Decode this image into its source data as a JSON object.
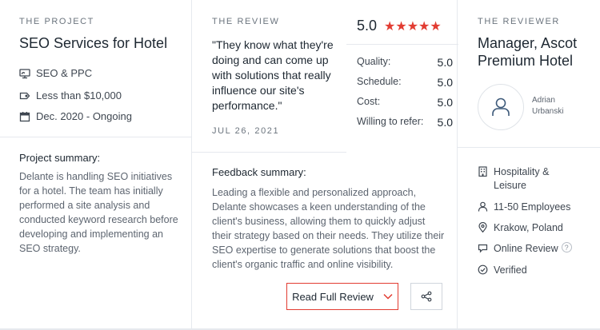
{
  "project": {
    "eyebrow": "THE PROJECT",
    "title": "SEO Services for Hotel",
    "service": "SEO & PPC",
    "budget": "Less than $10,000",
    "timeline": "Dec. 2020 - Ongoing",
    "summary_heading": "Project summary:",
    "summary_text": "Delante is handling SEO initiatives for a hotel. The team has initially performed a site analysis and conducted keyword research before developing and implementing an SEO strategy."
  },
  "review": {
    "eyebrow": "THE REVIEW",
    "quote": "\"They know what they're doing and can come up with solutions that really influence our site's performance.\"",
    "date": "JUL 26, 2021",
    "overall": "5.0",
    "stars": "★★★★★",
    "ratings": [
      {
        "label": "Quality:",
        "value": "5.0"
      },
      {
        "label": "Schedule:",
        "value": "5.0"
      },
      {
        "label": "Cost:",
        "value": "5.0"
      },
      {
        "label": "Willing to refer:",
        "value": "5.0"
      }
    ],
    "feedback_heading": "Feedback summary:",
    "feedback_text": "Leading a flexible and personalized approach, Delante showcases a keen understanding of the client's business, allowing them to quickly adjust their strategy based on their needs. They utilize their SEO expertise to generate solutions that boost the client's organic traffic and online visibility.",
    "read_full_label": "Read Full Review"
  },
  "reviewer": {
    "eyebrow": "THE REVIEWER",
    "title": "Manager, Ascot Premium Hotel",
    "name": "Adrian Urbanski",
    "industry": "Hospitality & Leisure",
    "employees": "11-50 Employees",
    "location": "Krakow, Poland",
    "review_type": "Online Review",
    "verified": "Verified"
  },
  "colors": {
    "accent": "#e23c32",
    "divider": "#e6e9ee",
    "text_dark": "#1d2731"
  },
  "icons": {
    "service": "monitor-icon",
    "budget": "price-tag-icon",
    "timeline": "calendar-icon",
    "industry": "building-icon",
    "employees": "person-icon",
    "location": "map-pin-icon",
    "review_type": "chat-bubble-icon",
    "verified": "check-circle-icon",
    "share": "share-icon",
    "avatar": "user-icon"
  }
}
